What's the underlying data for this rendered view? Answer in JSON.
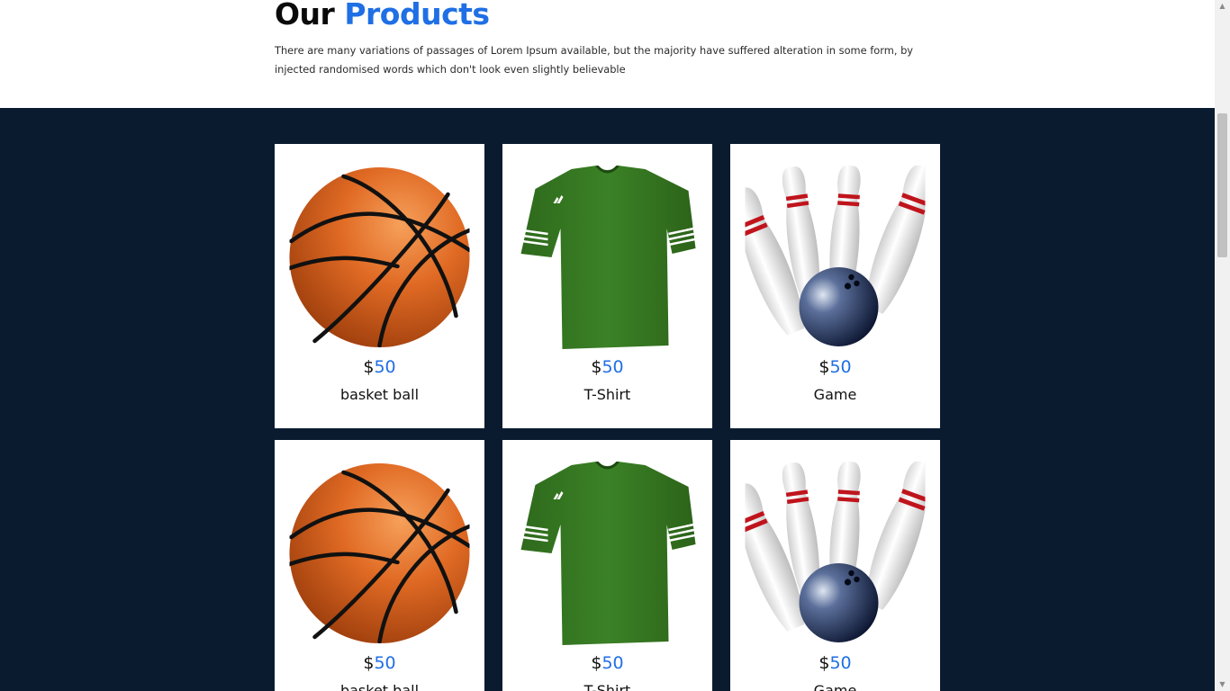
{
  "section": {
    "title_part1": "Our",
    "title_part2": "Products",
    "description": "There are many variations of passages of Lorem Ipsum available, but the majority have suffered alteration in some form, by injected randomised words which don't look even slightly believable"
  },
  "colors": {
    "accent": "#1f6fe5",
    "dark_background": "#0a1b30"
  },
  "products": [
    {
      "currency": "$",
      "price": "50",
      "name": "basket ball",
      "icon": "basketball-icon"
    },
    {
      "currency": "$",
      "price": "50",
      "name": "T-Shirt",
      "icon": "tshirt-icon"
    },
    {
      "currency": "$",
      "price": "50",
      "name": "Game",
      "icon": "bowling-icon"
    },
    {
      "currency": "$",
      "price": "50",
      "name": "basket ball",
      "icon": "basketball-icon"
    },
    {
      "currency": "$",
      "price": "50",
      "name": "T-Shirt",
      "icon": "tshirt-icon"
    },
    {
      "currency": "$",
      "price": "50",
      "name": "Game",
      "icon": "bowling-icon"
    }
  ]
}
